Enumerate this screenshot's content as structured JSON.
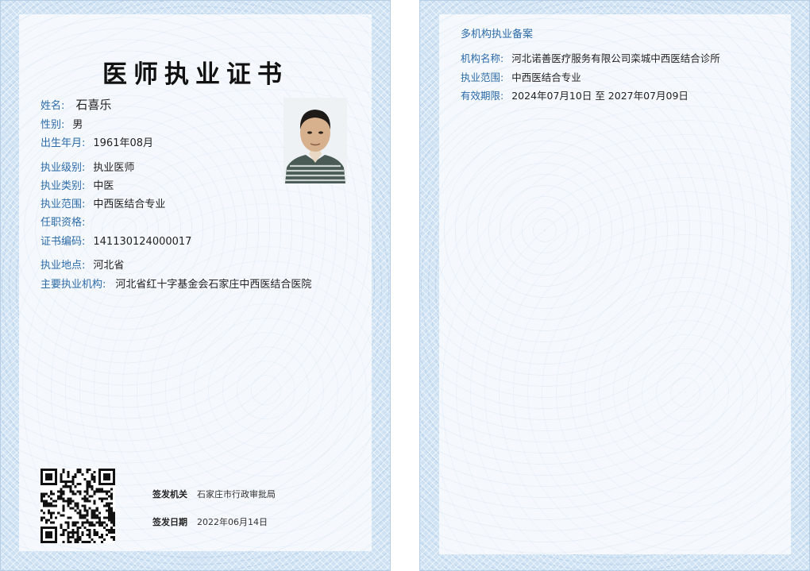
{
  "certificate": {
    "title": "医师执业证书",
    "fields": [
      {
        "label": "姓名:",
        "value": "石喜乐"
      },
      {
        "label": "性别:",
        "value": "男"
      },
      {
        "label": "出生年月:",
        "value": "1961年08月"
      },
      {
        "label": "执业级别:",
        "value": "执业医师"
      },
      {
        "label": "执业类别:",
        "value": "中医"
      },
      {
        "label": "执业范围:",
        "value": "中西医结合专业"
      },
      {
        "label": "任职资格:",
        "value": ""
      },
      {
        "label": "证书编码:",
        "value": "141130124000017"
      },
      {
        "label": "执业地点:",
        "value": "河北省"
      },
      {
        "label": "主要执业机构:",
        "value": "河北省红十字基金会石家庄中西医结合医院"
      }
    ],
    "issuing_authority": {
      "label": "签发机关",
      "value": "石家庄市行政审批局"
    },
    "issue_date": {
      "label": "签发日期",
      "value": "2022年06月14日"
    }
  },
  "multi_institution": {
    "heading": "多机构执业备案",
    "fields": [
      {
        "label": "机构名称:",
        "value": "河北诺善医疗服务有限公司栾城中西医结合诊所"
      },
      {
        "label": "执业范围:",
        "value": "中西医结合专业"
      },
      {
        "label": "有效期限:",
        "value": "2024年07月10日 至 2027年07月09日"
      }
    ]
  },
  "colors": {
    "label_blue": "#2c6aa8",
    "border_blue": "#cfe2f3",
    "paper": "#f5f9fd"
  }
}
